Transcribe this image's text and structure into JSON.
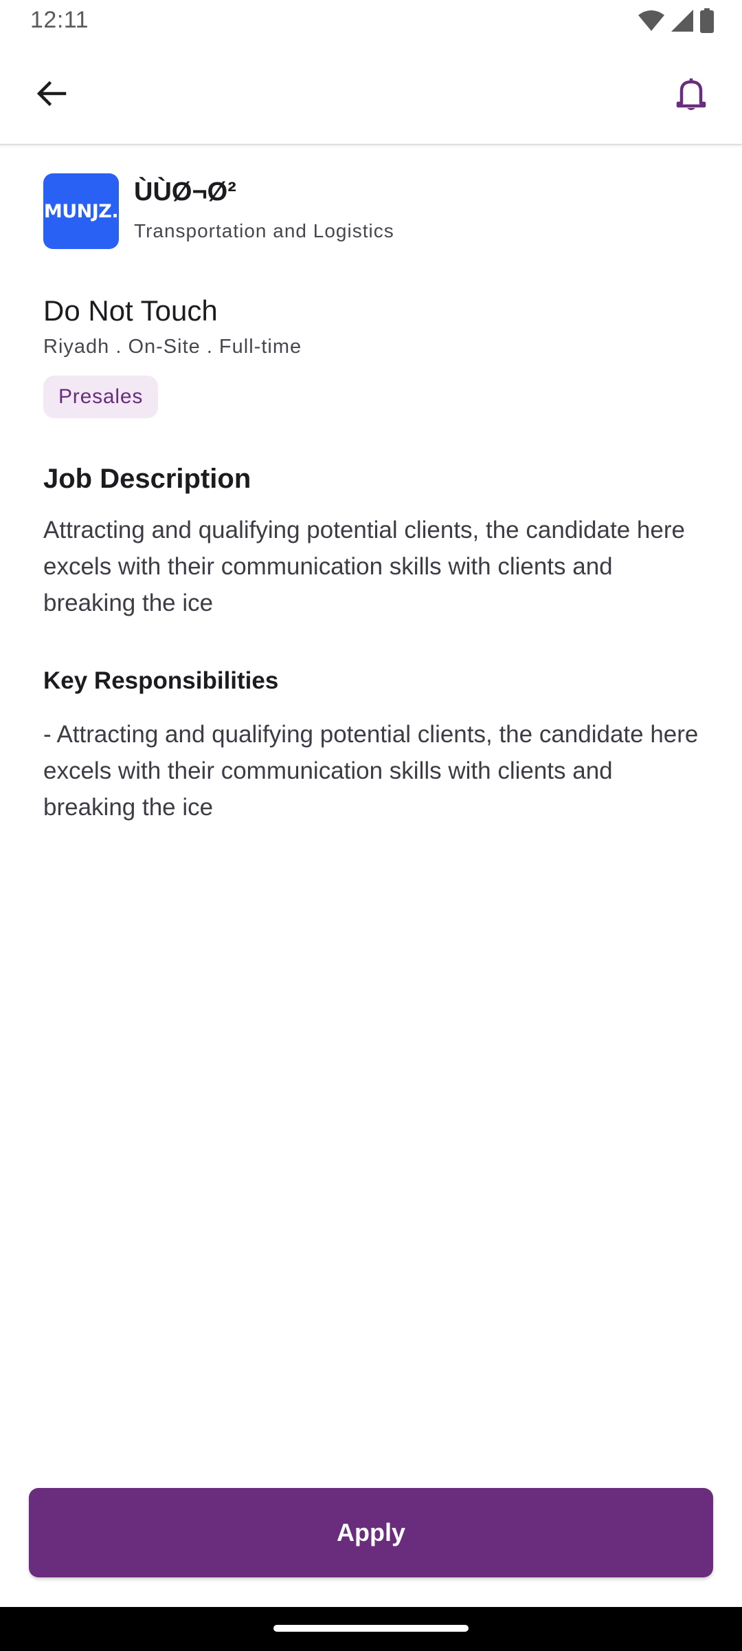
{
  "status_bar": {
    "time": "12:11",
    "icons": [
      "wifi-icon",
      "signal-icon",
      "battery-icon"
    ]
  },
  "app_bar": {
    "back_icon": "arrow-back-icon",
    "notification_icon": "bell-icon"
  },
  "company": {
    "logo_text": "MUNJZ.",
    "name": "ÙÙØ¬Ø²",
    "industry": "Transportation and Logistics"
  },
  "job": {
    "title": "Do Not Touch",
    "meta": "Riyadh . On-Site . Full-time",
    "tag": "Presales"
  },
  "description": {
    "heading": "Job Description",
    "text": "Attracting and qualifying potential clients, the candidate here excels with their communication skills with clients and breaking the ice"
  },
  "responsibilities": {
    "heading": "Key Responsibilities",
    "text": "- Attracting and qualifying potential clients, the candidate here excels with their communication skills with clients and breaking the ice"
  },
  "actions": {
    "apply_label": "Apply"
  },
  "colors": {
    "primary": "#6a2c7d",
    "chip_background": "#f2e9f5",
    "logo_background": "#2961f5"
  }
}
